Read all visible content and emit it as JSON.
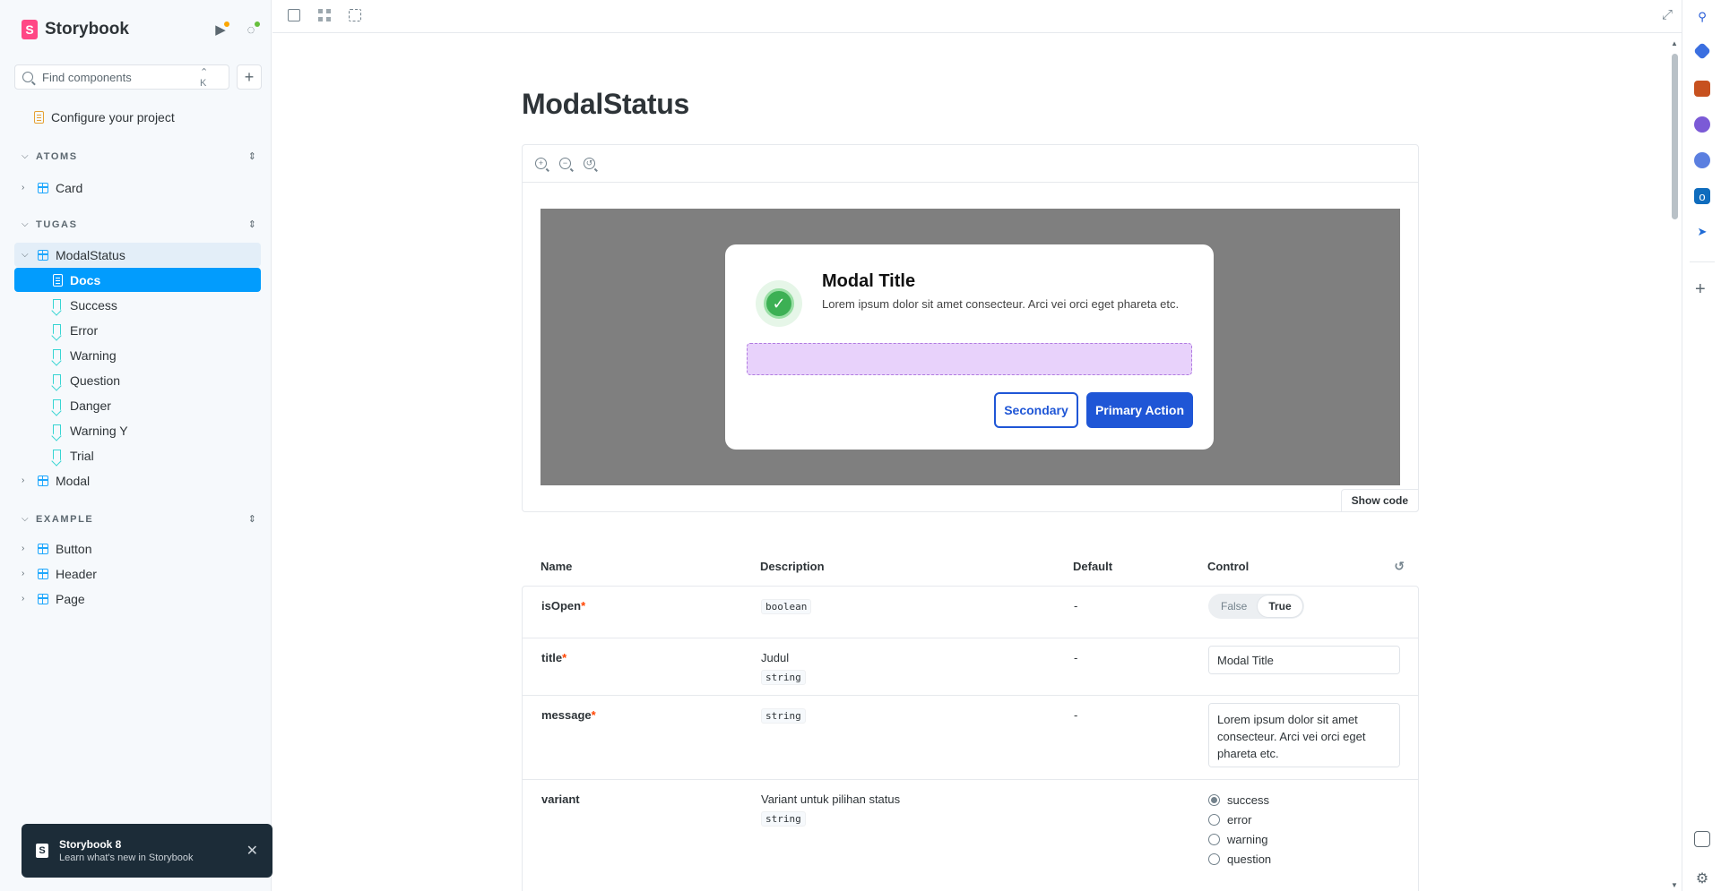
{
  "sidebar": {
    "brand": "Storybook",
    "search_placeholder": "Find components",
    "search_shortcut": "⌃ K",
    "configure_label": "Configure your project",
    "groups": [
      {
        "label": "ATOMS"
      },
      {
        "label": "TUGAS"
      },
      {
        "label": "EXAMPLE"
      }
    ],
    "atoms_items": [
      "Card"
    ],
    "tugas_parent": "ModalStatus",
    "stories": [
      "Docs",
      "Success",
      "Error",
      "Warning",
      "Question",
      "Danger",
      "Warning Y",
      "Trial"
    ],
    "tugas_modal": "Modal",
    "example_items": [
      "Button",
      "Header",
      "Page"
    ]
  },
  "toast": {
    "title": "Storybook 8",
    "subtitle": "Learn what's new in Storybook"
  },
  "docs": {
    "title": "ModalStatus",
    "show_code": "Show code"
  },
  "modal": {
    "title": "Modal Title",
    "message": "Lorem ipsum dolor sit amet consecteur. Arci vei orci eget phareta etc.",
    "secondary": "Secondary",
    "primary": "Primary Action"
  },
  "args": {
    "headers": {
      "name": "Name",
      "description": "Description",
      "default": "Default",
      "control": "Control"
    },
    "rows": [
      {
        "name": "isOpen",
        "required": "*",
        "description": "",
        "type": "boolean",
        "default": "-",
        "toggle": {
          "off": "False",
          "on": "True"
        }
      },
      {
        "name": "title",
        "required": "*",
        "description": "Judul",
        "type": "string",
        "default": "-",
        "value": "Modal Title"
      },
      {
        "name": "message",
        "required": "*",
        "description": "",
        "type": "string",
        "default": "-",
        "value": "Lorem ipsum dolor sit amet consecteur. Arci vei orci eget phareta etc."
      },
      {
        "name": "variant",
        "required": "",
        "description": "Variant untuk pilihan status",
        "type": "string",
        "default": "",
        "options": [
          "success",
          "error",
          "warning",
          "question"
        ],
        "selected": "success"
      }
    ]
  },
  "colors": {
    "accent": "#029cfd",
    "primary_button": "#1f56d6",
    "success": "#3cb054",
    "slot": "#e8d2fb"
  }
}
